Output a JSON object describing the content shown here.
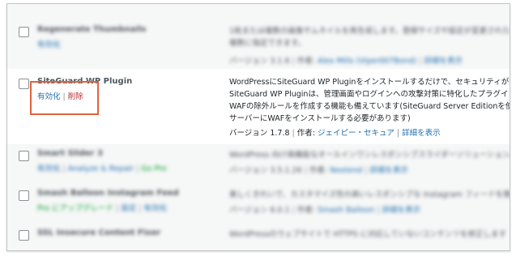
{
  "plugins": [
    {
      "name": "Regenerate Thumbnails",
      "actions": [
        {
          "label": "有効化",
          "kind": "link"
        }
      ],
      "description_lines": [
        "1枚または複数の画像サムネイルを再生成します。登録サイズや設定が変更された画像に",
        "複数に指定できます。"
      ],
      "version": "バージョン 3.1.6",
      "author_prefix": "作者:",
      "author": "Alex Mills (Viper007Bond)",
      "details": "詳細を表示"
    },
    {
      "name": "SiteGuard WP Plugin",
      "actions": [
        {
          "label": "有効化",
          "kind": "link"
        },
        {
          "label": "削除",
          "kind": "delete"
        }
      ],
      "description_lines": [
        "WordPressにSiteGuard WP Pluginをインストールするだけで、セキュリティが向上しま",
        "SiteGuard WP Pluginは、管理画面やログインへの攻撃対策に特化したプラグインです。",
        "WAFの除外ルールを作成する機能も備えています(SiteGuard Server Editionを使用するに",
        "サーバーにWAFをインストールする必要があります)"
      ],
      "version": "バージョン 1.7.8",
      "author_prefix": "作者:",
      "author": "ジェイピー・セキュア",
      "details": "詳細を表示"
    },
    {
      "name": "Smart Slider 3",
      "actions": [
        {
          "label": "有効化",
          "kind": "link"
        },
        {
          "label": "Analyze & Repair",
          "kind": "link"
        },
        {
          "label": "Go Pro",
          "kind": "green"
        }
      ],
      "description_lines": [
        "WordPress 向け高機能なオールインワンレスポンシブスライダーソリューション。"
      ],
      "version": "バージョン 3.5.1.26",
      "author_prefix": "作者:",
      "author": "Nextend",
      "details": "詳細を表示"
    },
    {
      "name": "Smash Balloon Instagram Feed",
      "actions": [
        {
          "label": "Pro にアップグレード",
          "kind": "green"
        },
        {
          "label": "設定",
          "kind": "link"
        },
        {
          "label": "有効化",
          "kind": "link"
        }
      ],
      "description_lines": [
        "美しくきれいで、カスタマイズ性の高いレスポンシブな Instagram フィードを簡単に表示"
      ],
      "version": "バージョン 6.0.1",
      "author_prefix": "作者:",
      "author": "Smash Balloon",
      "details": "詳細を表示"
    },
    {
      "name": "SSL Insecure Content Fixer",
      "actions": [],
      "description_lines": [
        "WordPressのウェブサイトで HTTPS に対応していないコンテンツを修正します"
      ],
      "version": "",
      "author_prefix": "",
      "author": "",
      "details": ""
    }
  ],
  "labels": {
    "separator": "|"
  }
}
